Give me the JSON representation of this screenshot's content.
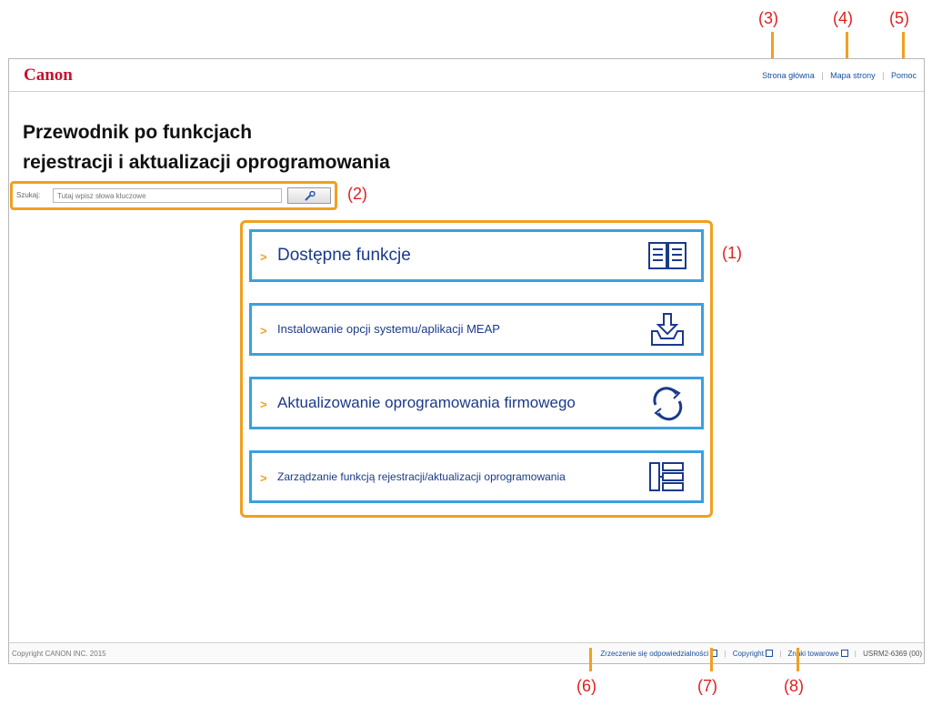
{
  "callouts": {
    "c1": "(1)",
    "c2": "(2)",
    "c3": "(3)",
    "c4": "(4)",
    "c5": "(5)",
    "c6": "(6)",
    "c7": "(7)",
    "c8": "(8)"
  },
  "header": {
    "logo": "Canon",
    "links": [
      "Strona główna",
      "Mapa strony",
      "Pomoc"
    ]
  },
  "page": {
    "title_line1": "Przewodnik po funkcjach",
    "title_line2": "rejestracji i aktualizacji oprogramowania"
  },
  "search": {
    "label": "Szukaj:",
    "placeholder": "Tutaj wpisz słowa kluczowe"
  },
  "menu": [
    {
      "label": "Dostępne funkcje",
      "icon": "book-icon"
    },
    {
      "label": "Instalowanie opcji systemu/aplikacji MEAP",
      "icon": "download-tray-icon"
    },
    {
      "label": "Aktualizowanie oprogramowania firmowego",
      "icon": "refresh-arrows-icon"
    },
    {
      "label": "Zarządzanie funkcją rejestracji/aktualizacji oprogramowania",
      "icon": "list-tree-icon"
    }
  ],
  "footer": {
    "copyright": "Copyright CANON INC. 2015",
    "links": [
      "Zrzeczenie się odpowiedzialności",
      "Copyright",
      "Znaki towarowe"
    ],
    "doc_id": "USRM2-6369 (00)"
  },
  "colors": {
    "accent_orange": "#f0a020",
    "menu_border": "#3aa0e0",
    "brand_red": "#c8102e"
  }
}
